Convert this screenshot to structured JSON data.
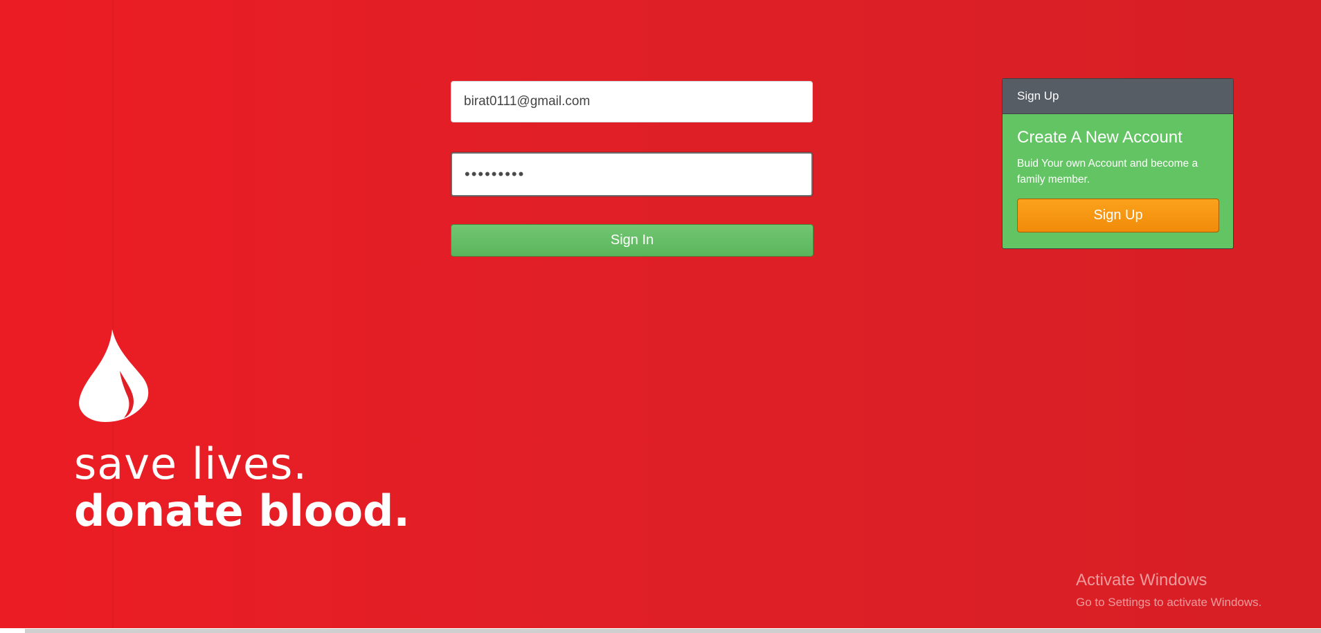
{
  "login": {
    "email_value": "birat0111@gmail.com",
    "password_value": "•••••••••",
    "signin_label": "Sign In"
  },
  "signup_panel": {
    "header": "Sign Up",
    "title": "Create A New Account",
    "text": "Buid Your own Account and become a family member.",
    "button_label": "Sign Up"
  },
  "branding": {
    "logo_icon": "blood-drop-icon",
    "slogan_line1": "save lives.",
    "slogan_line2": "donate blood."
  },
  "watermark": {
    "title": "Activate Windows",
    "subtitle": "Go to Settings to activate Windows."
  },
  "colors": {
    "background": "#e01f26",
    "signin_button": "#5cb85c",
    "panel_header": "#565d65",
    "panel_body": "#62c462",
    "signup_button": "#f7931e"
  }
}
